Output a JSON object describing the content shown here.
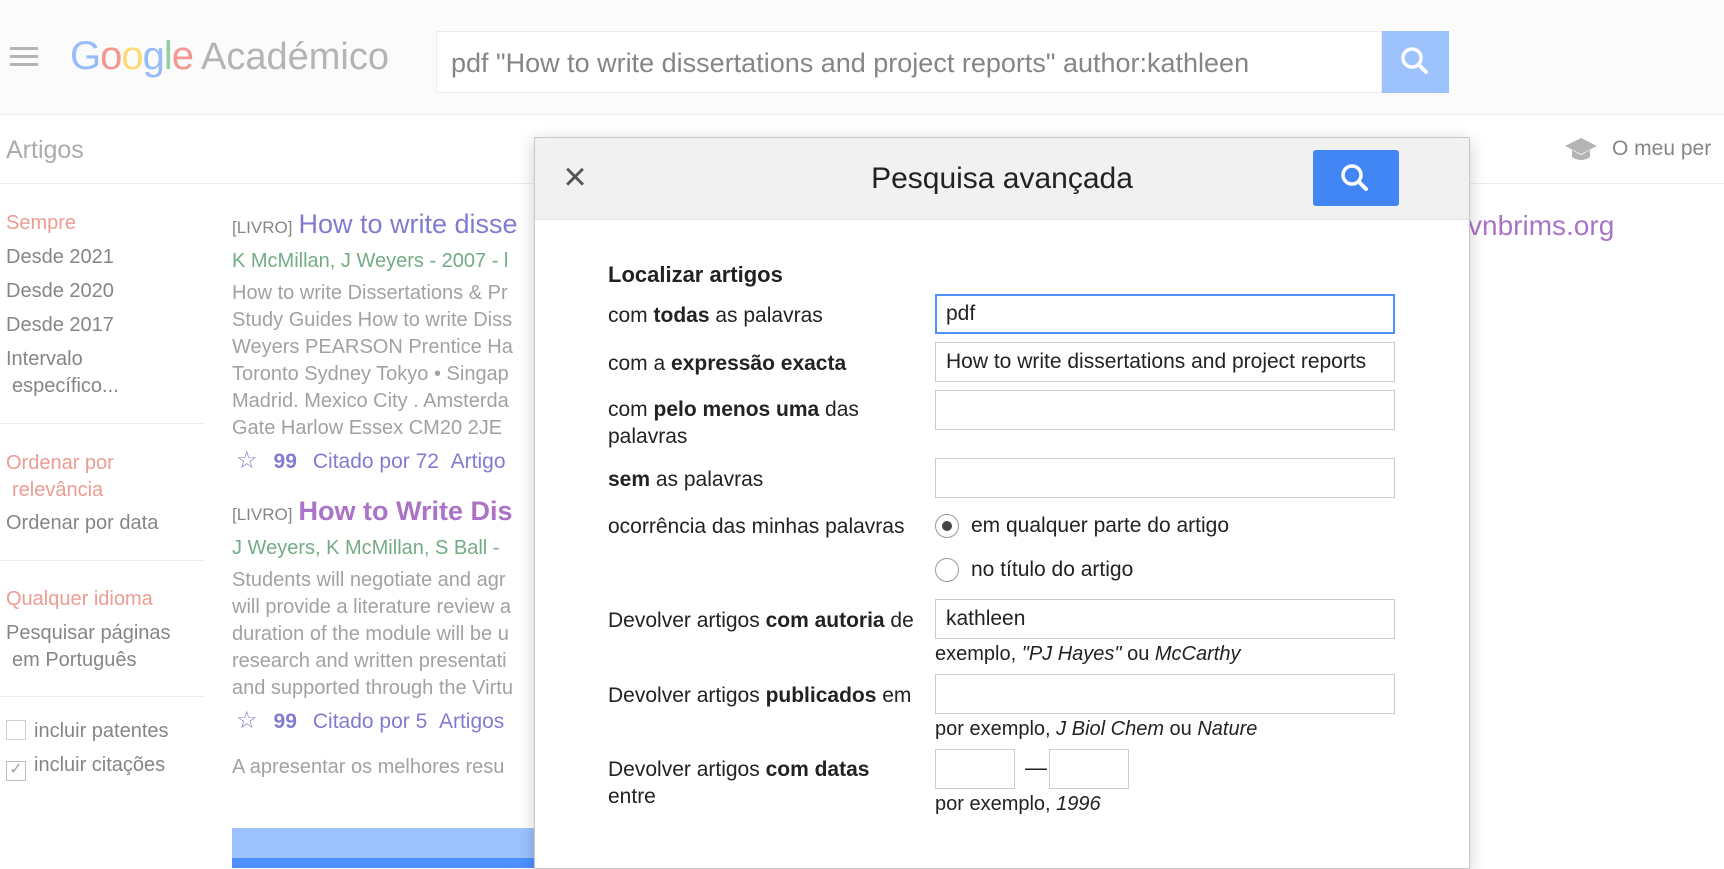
{
  "header": {
    "logo": {
      "g": "G",
      "o1": "o",
      "o2": "o",
      "g2": "g",
      "l": "l",
      "e": "e",
      "product": "Académico"
    },
    "search_value": "pdf \"How to write dissertations and project reports\" author:kathleen",
    "subnav_label": "Artigos",
    "my_profile": "O meu per"
  },
  "sidebar": {
    "time": [
      "Sempre",
      "Desde 2021",
      "Desde 2020",
      "Desde 2017",
      "Intervalo",
      "específico..."
    ],
    "sort": [
      "Ordenar por",
      "relevância",
      "Ordenar por data"
    ],
    "lang": [
      "Qualquer idioma",
      "Pesquisar páginas",
      "em Português"
    ],
    "include_patents": "incluir patentes",
    "include_citations": "incluir citações"
  },
  "results": [
    {
      "tag": "[LIVRO]",
      "title": "How to write disse",
      "authors": "K McMillan, J Weyers - 2007 - l",
      "snippet": [
        "How to write Dissertations & Pr",
        "Study Guides How to write Diss",
        "Weyers PEARSON Prentice Ha",
        "Toronto Sydney Tokyo • Singap",
        "Madrid. Mexico City . Amsterda",
        "Gate Harlow Essex CM20 2JE"
      ],
      "cited": "Citado por 72",
      "more": "Artigo"
    },
    {
      "tag": "[LIVRO]",
      "title": "How to Write Dis",
      "authors": "J Weyers, K McMillan, S Ball -",
      "snippet": [
        "Students will negotiate and agr",
        "will provide a literature review a",
        "duration of the module will be u",
        "research and written presentati",
        "and supported through the Virtu"
      ],
      "cited": "Citado por 5",
      "more": "Artigos"
    }
  ],
  "results_footer": "A apresentar os melhores resu",
  "side_source": "vnbrims.org",
  "dialog": {
    "title": "Pesquisa avançada",
    "section": "Localizar artigos",
    "all_words": {
      "pre": "com ",
      "bold": "todas",
      "post": " as palavras",
      "value": "pdf"
    },
    "exact": {
      "pre": "com a ",
      "bold": "expressão exacta",
      "value": "How to write dissertations and project reports"
    },
    "atleast": {
      "pre": "com ",
      "bold": "pelo menos uma",
      "post": " das",
      "line2": "palavras",
      "value": ""
    },
    "without": {
      "bold": "sem",
      "post": " as palavras",
      "value": ""
    },
    "occurrence": {
      "label": "ocorrência das minhas palavras",
      "opt1": "em qualquer parte do artigo",
      "opt2": "no título do artigo"
    },
    "author": {
      "pre": "Devolver artigos ",
      "bold": "com autoria",
      "post": " de",
      "value": "kathleen",
      "hint_pre": "exemplo, ",
      "hint_i1": "\"PJ Hayes\"",
      "hint_mid": " ou ",
      "hint_i2": "McCarthy"
    },
    "published": {
      "pre": "Devolver artigos ",
      "bold": "publicados",
      "post": " em",
      "value": "",
      "hint_pre": "por exemplo, ",
      "hint_i1": "J Biol Chem",
      "hint_mid": " ou ",
      "hint_i2": "Nature"
    },
    "dates": {
      "pre": "Devolver artigos ",
      "bold": "com datas",
      "line2": "entre",
      "dash": "—",
      "hint_pre": "por exemplo, ",
      "hint_i": "1996"
    }
  },
  "colors": {
    "accent": "#4285f4",
    "link": "#1a0dab",
    "author_green": "#006621",
    "sidebar_red": "#dd4b39"
  }
}
